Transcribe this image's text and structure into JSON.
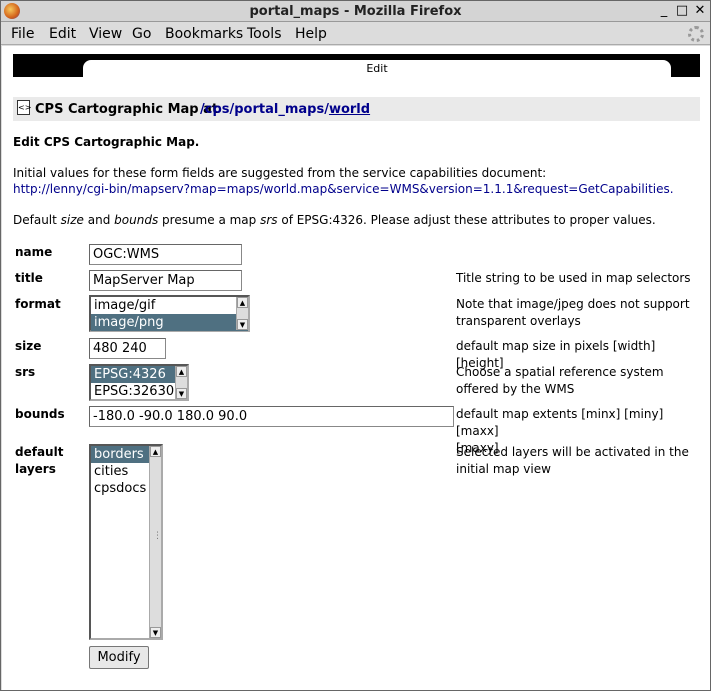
{
  "window": {
    "title": "portal_maps - Mozilla Firefox"
  },
  "menu": [
    "File",
    "Edit",
    "View",
    "Go",
    "Bookmarks",
    "Tools",
    "Help"
  ],
  "tab": {
    "label": "Edit"
  },
  "breadcrumb": {
    "label": "CPS Cartographic Map at",
    "sep": "/",
    "parts": [
      "cps",
      "portal_maps",
      "world"
    ]
  },
  "heading": "Edit CPS Cartographic Map.",
  "intro": "Initial values for these form fields are suggested from the service capabilities document:",
  "capabilities_url": "http://lenny/cgi-bin/mapserv?map=maps/world.map&service=WMS&version=1.1.1&request=GetCapabilities.",
  "notice": {
    "t1": "Default ",
    "size": "size",
    "t2": " and ",
    "bounds": "bounds",
    "t3": " presume a map ",
    "srs": "srs",
    "t4": " of EPSG:4326. Please adjust these attributes to proper values."
  },
  "form": {
    "name": {
      "label": "name",
      "value": "OGC:WMS"
    },
    "title": {
      "label": "title",
      "value": "MapServer Map",
      "desc": "Title string to be used in map selectors"
    },
    "format": {
      "label": "format",
      "options": [
        "image/gif",
        "image/png"
      ],
      "selected": "image/png",
      "desc1": "Note that image/jpeg does not support",
      "desc2": "transparent overlays"
    },
    "size": {
      "label": "size",
      "value": "480 240",
      "desc": "default map size in pixels [width] [height]"
    },
    "srs": {
      "label": "srs",
      "options": [
        "EPSG:4326",
        "EPSG:32630"
      ],
      "selected": "EPSG:4326",
      "desc1": "Choose a spatial reference system",
      "desc2": "offered by the WMS"
    },
    "bounds": {
      "label": "bounds",
      "value": "-180.0 -90.0 180.0 90.0",
      "desc1": "default map extents [minx] [miny] [maxx]",
      "desc2": "[maxy]"
    },
    "layers": {
      "label1": "default",
      "label2": "layers",
      "options": [
        "borders",
        "cities",
        "cpsdocs"
      ],
      "selected": "borders",
      "desc1": "Selected layers will be activated in the",
      "desc2": "initial map view"
    }
  },
  "submit_label": "Modify"
}
